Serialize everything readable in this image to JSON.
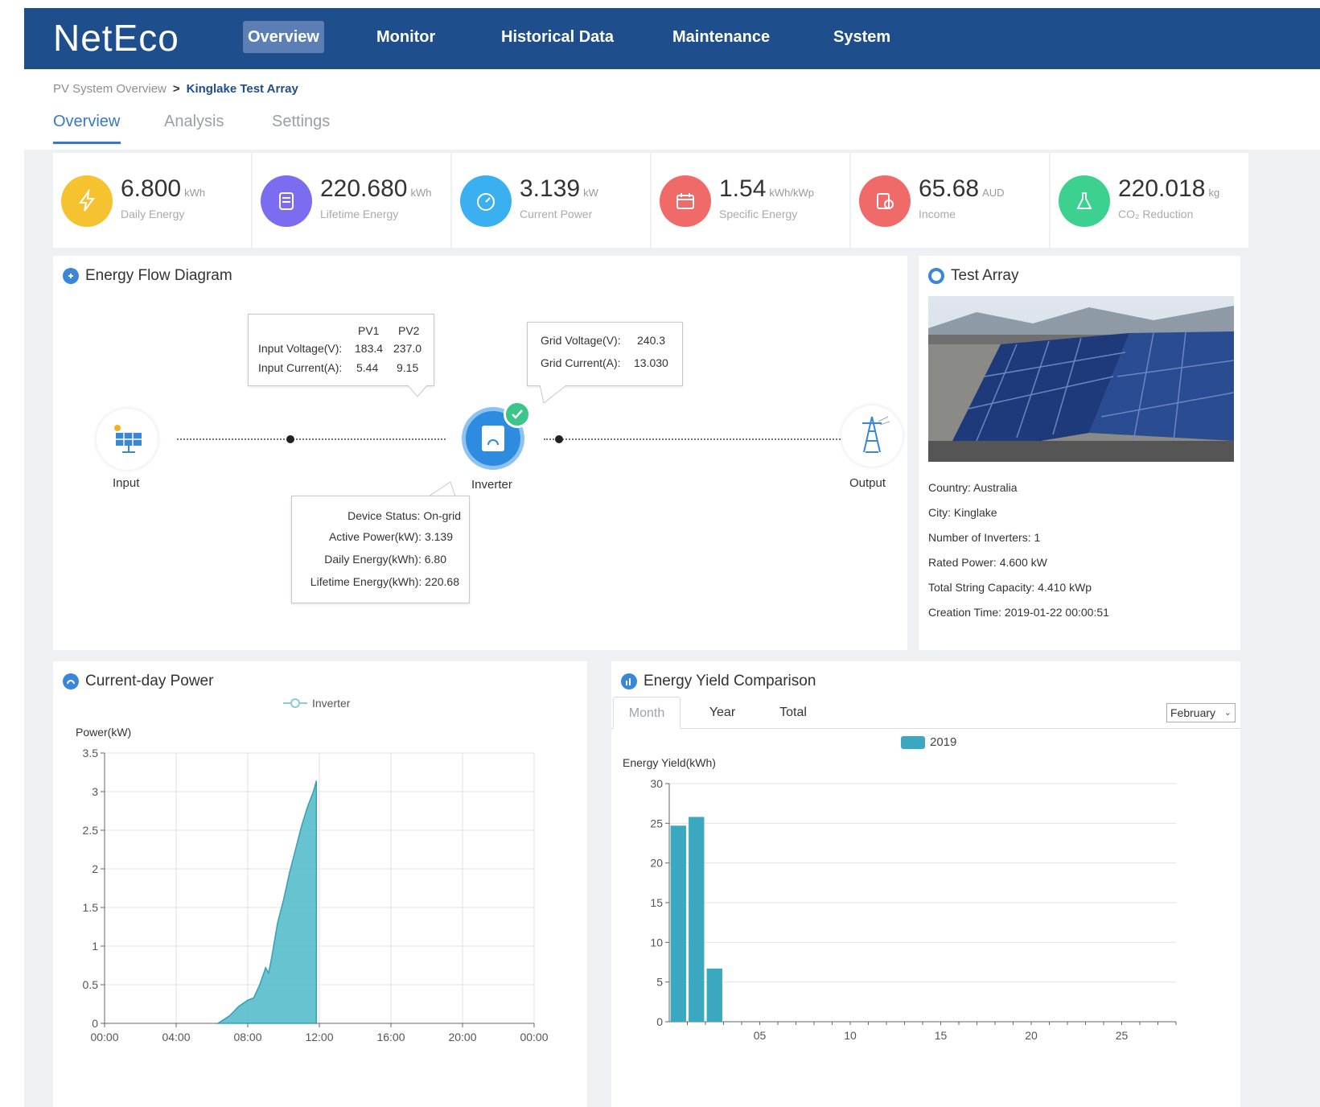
{
  "app": {
    "logo": "NetEco"
  },
  "nav": {
    "items": [
      "Overview",
      "Monitor",
      "Historical Data",
      "Maintenance",
      "System"
    ]
  },
  "breadcrumb": {
    "root": "PV System Overview",
    "separator": ">",
    "current": "Kinglake Test Array"
  },
  "tabs": [
    "Overview",
    "Analysis",
    "Settings"
  ],
  "kpis": [
    {
      "value": "6.800",
      "unit": "kWh",
      "label": "Daily Energy",
      "color": "#f5c230",
      "icon": "lightning-icon"
    },
    {
      "value": "220.680",
      "unit": "kWh",
      "label": "Lifetime Energy",
      "color": "#7b6cf0",
      "icon": "meter-icon"
    },
    {
      "value": "3.139",
      "unit": "kW",
      "label": "Current Power",
      "color": "#3bb0f0",
      "icon": "gauge-icon"
    },
    {
      "value": "1.54",
      "unit": "kWh/kWp",
      "label": "Specific Energy",
      "color": "#f06a6a",
      "icon": "calendar-icon"
    },
    {
      "value": "65.68",
      "unit": "AUD",
      "label": "Income",
      "color": "#f06a6a",
      "icon": "coins-icon"
    },
    {
      "value": "220.018",
      "unit": "kg",
      "label": "CO₂ Reduction",
      "color": "#3cd18f",
      "icon": "flask-icon"
    }
  ],
  "energy_flow": {
    "title": "Energy Flow Diagram",
    "pv": {
      "col1": "PV1",
      "col2": "PV2",
      "rows": [
        {
          "label": "Input Voltage(V):",
          "pv1": "183.4",
          "pv2": "237.0"
        },
        {
          "label": "Input Current(A):",
          "pv1": "5.44",
          "pv2": "9.15"
        }
      ]
    },
    "grid": {
      "rows": [
        {
          "label": "Grid Voltage(V):",
          "value": "240.3"
        },
        {
          "label": "Grid Current(A):",
          "value": "13.030"
        }
      ]
    },
    "device": {
      "rows": [
        {
          "label": "Device Status:",
          "value": "On-grid"
        },
        {
          "label": "Active Power(kW):",
          "value": "3.139"
        },
        {
          "label": "Daily Energy(kWh):",
          "value": "6.80"
        },
        {
          "label": "Lifetime Energy(kWh):",
          "value": "220.68"
        }
      ]
    },
    "labels": {
      "input": "Input",
      "inverter": "Inverter",
      "output": "Output"
    }
  },
  "test_array": {
    "title": "Test Array",
    "info": [
      "Country: Australia",
      "City: Kinglake",
      "Number of Inverters: 1",
      "Rated Power: 4.600 kW",
      "Total String Capacity: 4.410 kWp",
      "Creation Time: 2019-01-22 00:00:51"
    ]
  },
  "power_chart": {
    "title": "Current-day Power",
    "legend": "Inverter",
    "ylabel": "Power(kW)",
    "color": "#4db8c9"
  },
  "yield_chart": {
    "title": "Energy Yield Comparison",
    "tabs": [
      "Month",
      "Year",
      "Total"
    ],
    "month_select": "February",
    "legend": "2019",
    "ylabel": "Energy Yield(kWh)",
    "color": "#3aa8c0"
  },
  "chart_data": [
    {
      "type": "area",
      "series": [
        {
          "name": "Inverter",
          "x": [
            "06:20",
            "07:00",
            "07:30",
            "08:00",
            "08:20",
            "08:40",
            "09:00",
            "09:10",
            "09:20",
            "09:40",
            "10:00",
            "10:20",
            "10:40",
            "11:00",
            "11:20",
            "11:40",
            "11:50"
          ],
          "values": [
            0,
            0.1,
            0.22,
            0.3,
            0.33,
            0.5,
            0.72,
            0.65,
            0.85,
            1.3,
            1.6,
            1.95,
            2.25,
            2.55,
            2.8,
            3.0,
            3.14
          ]
        }
      ],
      "xlim": [
        "00:00",
        "24:00"
      ],
      "x_ticks": [
        "00:00",
        "04:00",
        "08:00",
        "12:00",
        "16:00",
        "20:00",
        "00:00"
      ],
      "ylim": [
        0,
        3.5
      ],
      "y_ticks": [
        "0",
        "0.5",
        "1",
        "1.5",
        "2",
        "2.5",
        "3",
        "3.5"
      ],
      "ylabel": "Power(kW)",
      "grid": true
    },
    {
      "type": "bar",
      "categories": [
        1,
        2,
        3
      ],
      "series": [
        {
          "name": "2019",
          "values": [
            24.7,
            25.8,
            6.7
          ]
        }
      ],
      "xlim": [
        0,
        28
      ],
      "x_ticks": [
        "05",
        "10",
        "15",
        "20",
        "25"
      ],
      "ylim": [
        0,
        30
      ],
      "y_ticks": [
        "0",
        "5",
        "10",
        "15",
        "20",
        "25",
        "30"
      ],
      "ylabel": "Energy Yield(kWh)",
      "grid": true
    }
  ]
}
